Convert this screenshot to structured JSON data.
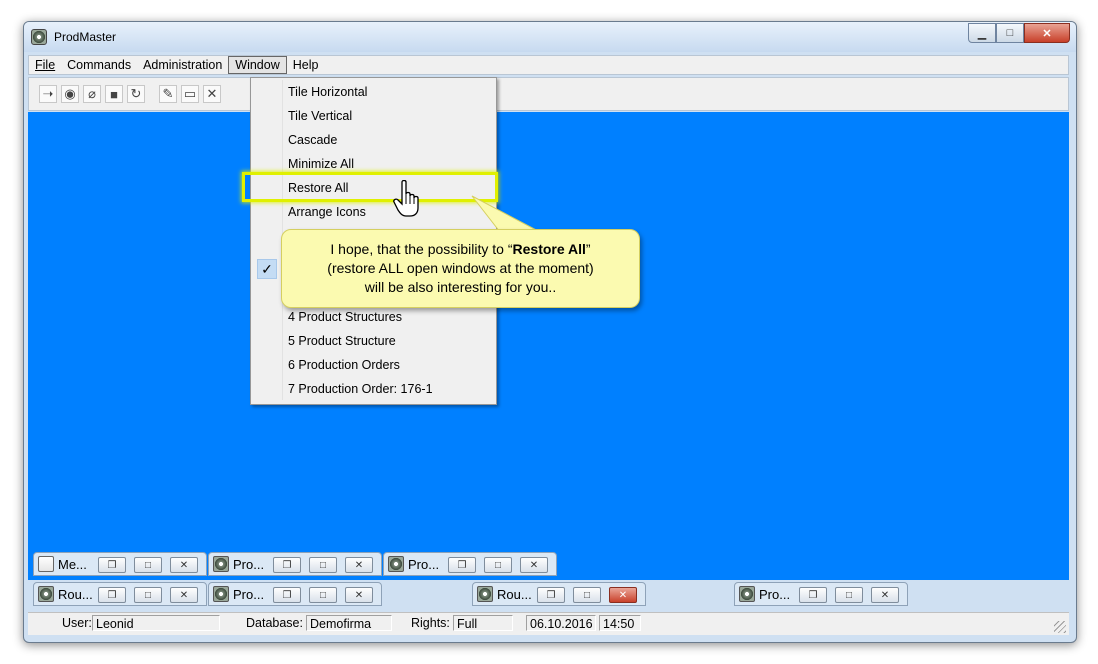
{
  "window": {
    "title": "ProdMaster",
    "app_icon": "gear-app-icon"
  },
  "caption_buttons": {
    "minimize": "▁",
    "maximize": "□",
    "close": "✕"
  },
  "menubar": {
    "file": "File",
    "commands": "Commands",
    "administration": "Administration",
    "window": "Window",
    "help": "Help"
  },
  "toolbar": {
    "icons": [
      "arrow-icon",
      "binoculars-icon",
      "eraser-icon",
      "stop-icon",
      "refresh-icon",
      "new-folder-icon",
      "window-icon",
      "close-x-icon"
    ]
  },
  "window_menu": {
    "items": [
      "Tile Horizontal",
      "Tile Vertical",
      "Cascade",
      "Minimize All",
      "Restore All",
      "Arrange Icons",
      "4 Product Structures",
      "5 Product Structure",
      "6 Production Orders",
      "7 Production Order: 176-1"
    ],
    "checked_mark": "✓"
  },
  "callout": {
    "line1_pre": "I hope, that the possibility to “",
    "line1_bold": "Restore All",
    "line1_post": "”",
    "line2": "(restore ALL open windows at the moment)",
    "line3": "will be also interesting for you..",
    "background": "#fbfab0"
  },
  "minimized_windows": {
    "w1": "Me...",
    "w2": "Pro...",
    "w3": "Pro...",
    "w4": "Rou...",
    "w5": "Pro...",
    "w6": "Rou...",
    "w7": "Pro..."
  },
  "status": {
    "user_label": "User:",
    "user_value": "Leonid",
    "db_label": "Database:",
    "db_value": "Demofirma",
    "rights_label": "Rights:",
    "rights_value": "Full",
    "date": "06.10.2016",
    "time": "14:50"
  },
  "colors": {
    "desktop": "#0080ff",
    "highlight": "#e0f000"
  }
}
